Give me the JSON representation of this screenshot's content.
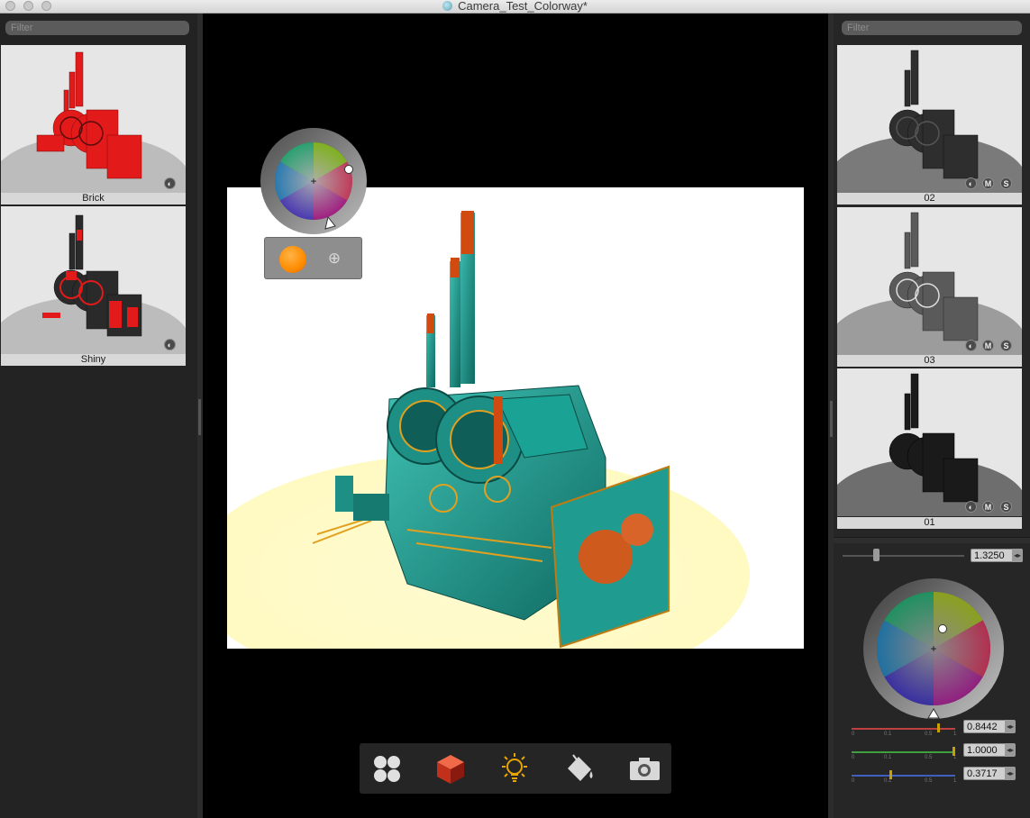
{
  "window": {
    "title": "Camera_Test_Colorway*"
  },
  "left_panel": {
    "filter_placeholder": "Filter",
    "items": [
      {
        "label": "Brick",
        "color": "#e21a1a"
      },
      {
        "label": "Shiny",
        "color": "#e21a1a"
      }
    ]
  },
  "right_panel": {
    "filter_placeholder": "Filter",
    "items": [
      {
        "label": "02"
      },
      {
        "label": "03"
      },
      {
        "label": "01"
      }
    ],
    "item_buttons": {
      "m": "M",
      "s": "S"
    },
    "intensity": {
      "value": "1.3250"
    },
    "channels": [
      {
        "value": "0.8442",
        "color": "#c04040"
      },
      {
        "value": "1.0000",
        "color": "#3fa03f"
      },
      {
        "value": "0.3717",
        "color": "#4060c0"
      }
    ],
    "slider_ticks": [
      "0",
      "0.1",
      "0.5",
      "1"
    ]
  },
  "viewport": {
    "selected_color": "#ff8c00",
    "add_symbol": "⊕"
  },
  "toolbar": {
    "buttons": [
      {
        "name": "library",
        "icon": "four-dots-icon"
      },
      {
        "name": "materials",
        "icon": "cube-icon"
      },
      {
        "name": "lighting",
        "icon": "lightbulb-icon"
      },
      {
        "name": "paint",
        "icon": "paint-bucket-icon"
      },
      {
        "name": "camera",
        "icon": "camera-icon"
      }
    ]
  }
}
